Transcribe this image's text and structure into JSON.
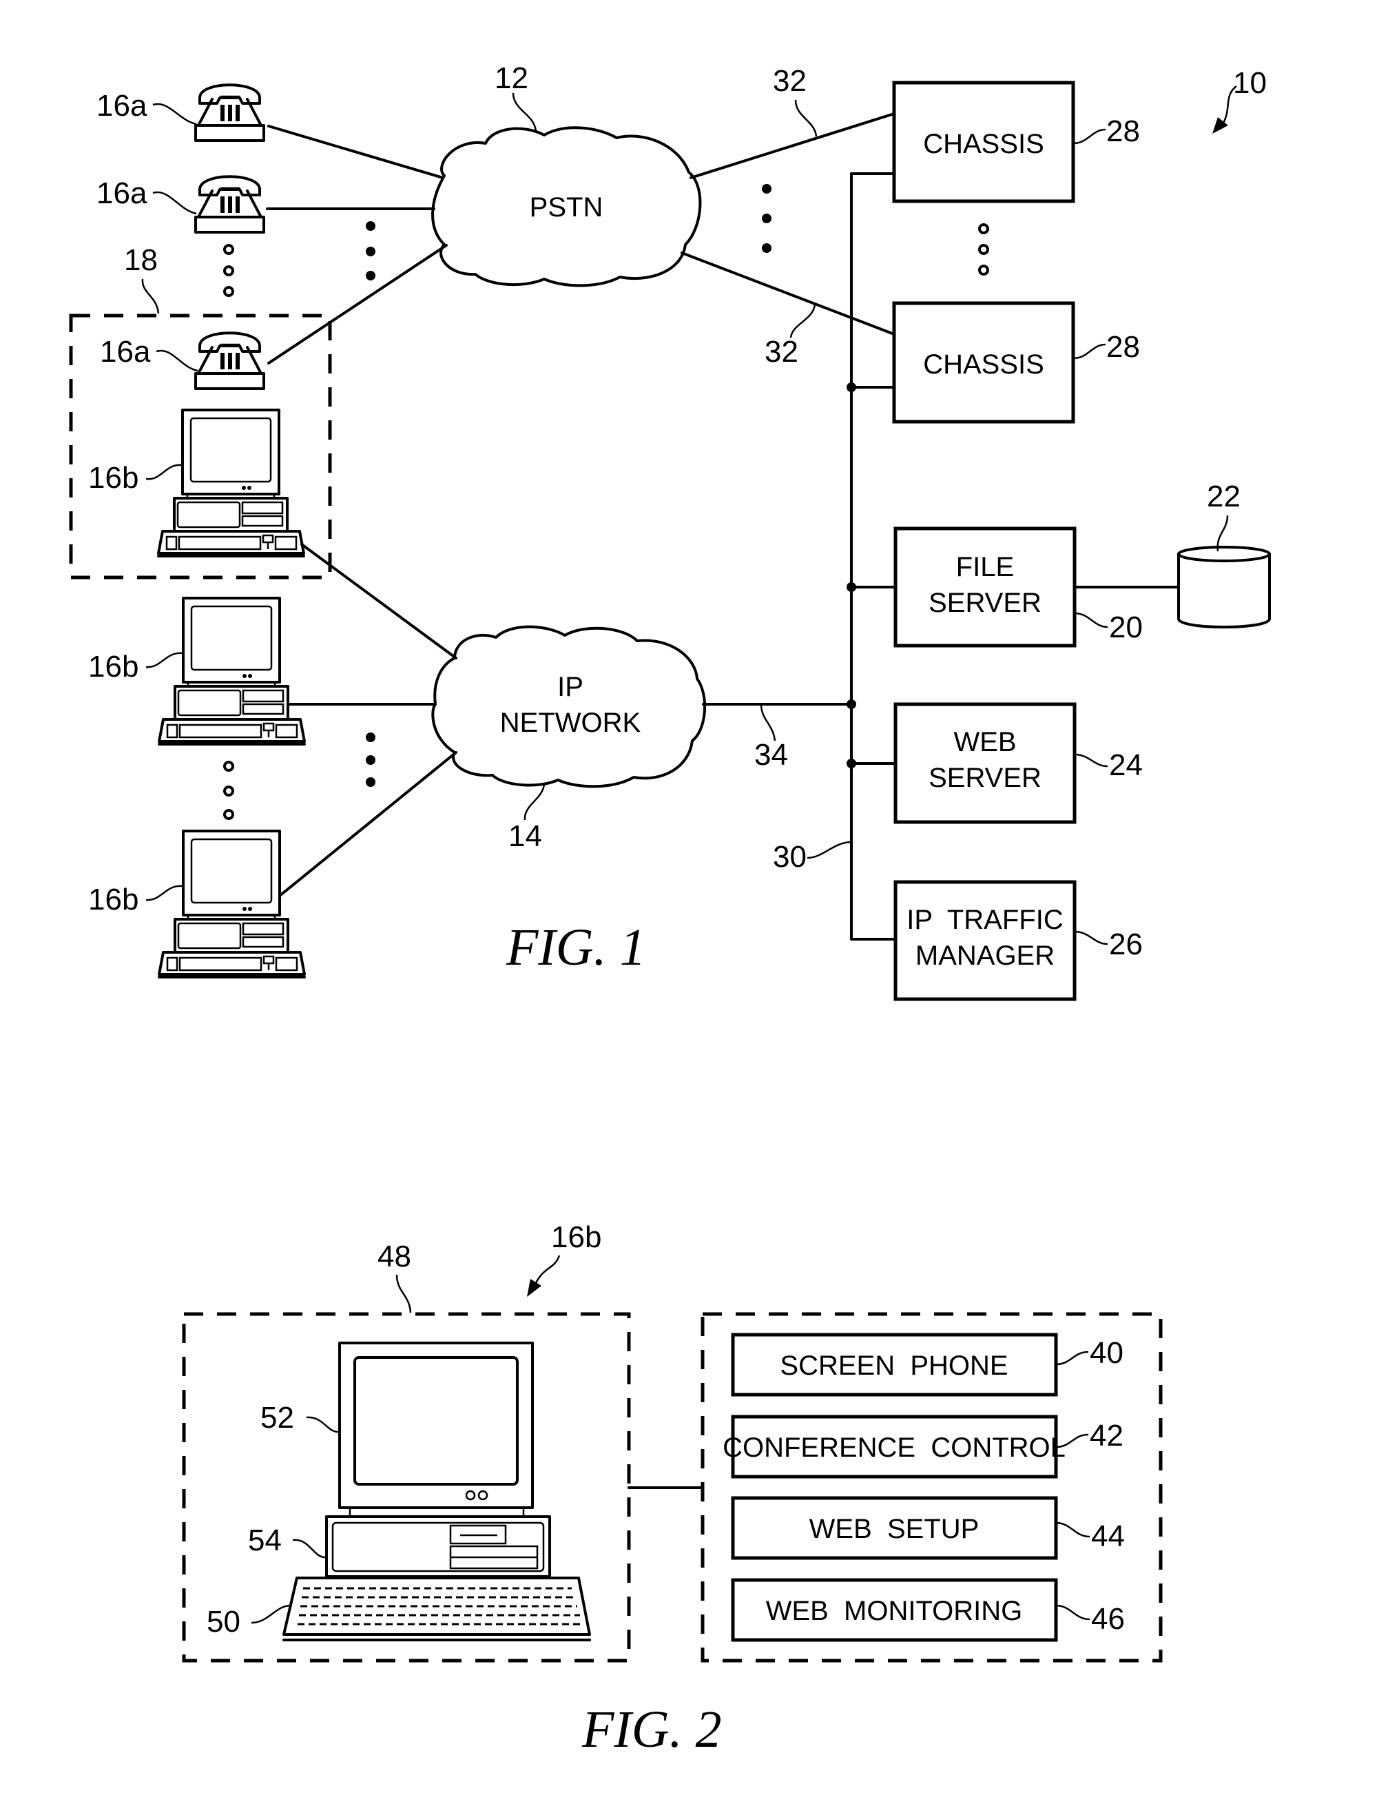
{
  "figure1": {
    "caption": "FIG. 1",
    "system_ref": "10",
    "clouds": {
      "pstn": {
        "label": "PSTN",
        "ref": "12"
      },
      "ip_network": {
        "label_line1": "IP",
        "label_line2": "NETWORK",
        "ref": "14"
      }
    },
    "phones": [
      {
        "ref": "16a"
      },
      {
        "ref": "16a"
      },
      {
        "ref": "16a"
      }
    ],
    "computers": [
      {
        "ref": "16b"
      },
      {
        "ref": "16b"
      },
      {
        "ref": "16b"
      }
    ],
    "group_ref": "18",
    "boxes": {
      "chassis_top": {
        "label": "CHASSIS",
        "ref": "28"
      },
      "chassis_bottom": {
        "label": "CHASSIS",
        "ref": "28"
      },
      "file_server": {
        "label_line1": "FILE",
        "label_line2": "SERVER",
        "ref": "20"
      },
      "web_server": {
        "label_line1": "WEB",
        "label_line2": "SERVER",
        "ref": "24"
      },
      "ip_traffic_manager": {
        "label_line1": "IP  TRAFFIC",
        "label_line2": "MANAGER",
        "ref": "26"
      }
    },
    "database_ref": "22",
    "links": {
      "pstn_chassis_top": "32",
      "pstn_chassis_bottom": "32",
      "ip_bus": "34",
      "bus": "30"
    }
  },
  "figure2": {
    "caption": "FIG. 2",
    "terminal_ref": "16b",
    "hardware_group_ref": "48",
    "monitor_ref": "52",
    "cpu_ref": "54",
    "keyboard_ref": "50",
    "modules": [
      {
        "label": "SCREEN  PHONE",
        "ref": "40"
      },
      {
        "label": "CONFERENCE  CONTROL",
        "ref": "42"
      },
      {
        "label": "WEB  SETUP",
        "ref": "44"
      },
      {
        "label": "WEB  MONITORING",
        "ref": "46"
      }
    ]
  }
}
